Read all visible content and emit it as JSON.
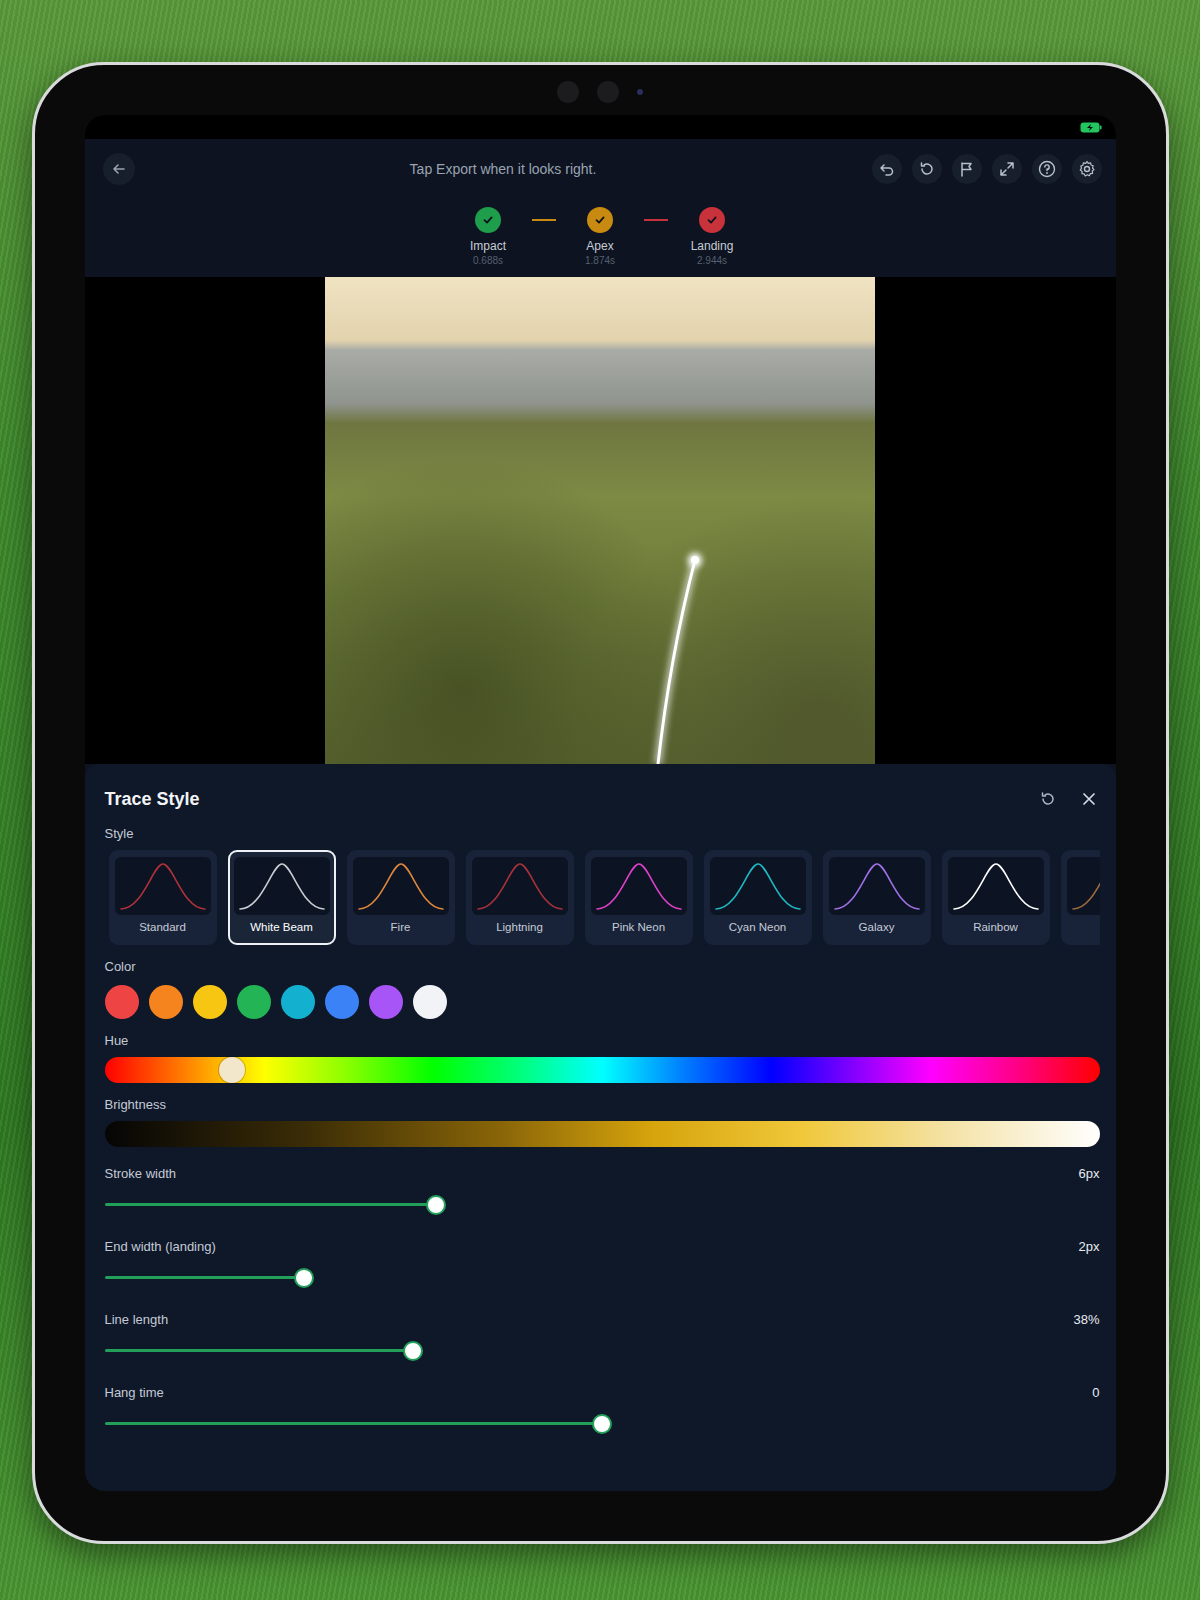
{
  "toolbar": {
    "hint": "Tap Export when it looks right."
  },
  "steps": [
    {
      "label": "Impact",
      "time": "0.688s",
      "done": true,
      "color": "#1e9e4a"
    },
    {
      "label": "Apex",
      "time": "1.874s",
      "done": true,
      "color": "#c98a12"
    },
    {
      "label": "Landing",
      "time": "2.944s",
      "done": true,
      "color": "#c8323a"
    }
  ],
  "trace_style": {
    "title": "Trace Style",
    "style_label": "Style",
    "styles": [
      {
        "label": "Standard",
        "selected": false,
        "color": "#b0323a"
      },
      {
        "label": "White Beam",
        "selected": true,
        "color": "#c9ccd2"
      },
      {
        "label": "Fire",
        "selected": false,
        "color": "#e0873a"
      },
      {
        "label": "Lightning",
        "selected": false,
        "color": "#a8323c"
      },
      {
        "label": "Pink Neon",
        "selected": false,
        "color": "#e040c8"
      },
      {
        "label": "Cyan Neon",
        "selected": false,
        "color": "#1fb8c4"
      },
      {
        "label": "Galaxy",
        "selected": false,
        "color": "#a070e8"
      },
      {
        "label": "Rainbow",
        "selected": false,
        "color": "#ffffff"
      },
      {
        "label": "",
        "selected": false,
        "color": "#9a6a40"
      }
    ],
    "color_label": "Color",
    "colors": [
      {
        "color": "#ef4444",
        "selected": false
      },
      {
        "color": "#f5841f",
        "selected": false
      },
      {
        "color": "#f7c612",
        "selected": false
      },
      {
        "color": "#22b455",
        "selected": false
      },
      {
        "color": "#13b1cf",
        "selected": false
      },
      {
        "color": "#3b82f6",
        "selected": false
      },
      {
        "color": "#a855f7",
        "selected": false
      },
      {
        "color": "#f1f3f6",
        "selected": false
      }
    ],
    "hue": {
      "label": "Hue",
      "level": 0.128
    },
    "brightness": {
      "label": "Brightness"
    },
    "sliders": [
      {
        "label": "Stroke width",
        "reading": "6px",
        "level": 0.333
      },
      {
        "label": "End width (landing)",
        "reading": "2px",
        "level": 0.2
      },
      {
        "label": "Line length",
        "reading": "38%",
        "level": 0.31
      },
      {
        "label": "Hang time",
        "reading": "0",
        "level": 0.5
      }
    ]
  }
}
